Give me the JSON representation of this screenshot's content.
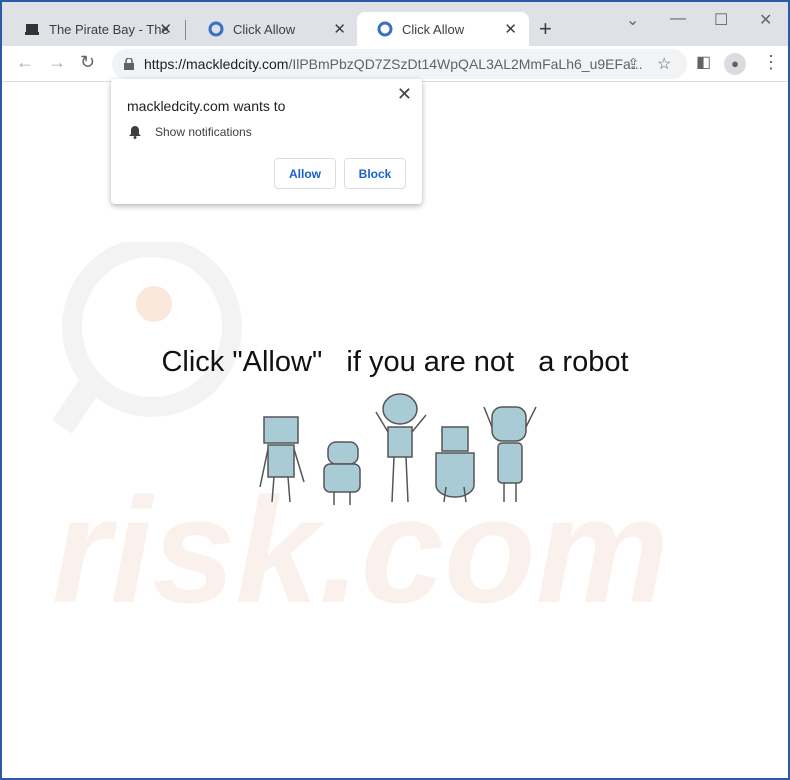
{
  "tabs": [
    {
      "title": "The Pirate Bay - The",
      "icon": "pirate-ship-icon",
      "active": false
    },
    {
      "title": "Click Allow",
      "icon": "page-favicon-icon",
      "active": false
    },
    {
      "title": "Click Allow",
      "icon": "page-favicon-icon",
      "active": true
    }
  ],
  "address": {
    "host": "https://mackledcity.com",
    "path": "/IlPBmPbzQD7ZSzDt14WpQAL3AL2MmFaLh6_u9EFa..."
  },
  "popup": {
    "title": "mackledcity.com wants to",
    "permission": "Show notifications",
    "allow": "Allow",
    "block": "Block"
  },
  "page": {
    "headline": "Click \"Allow\"   if you are not   a robot"
  },
  "watermark": "risk.com",
  "colors": {
    "border": "#2b5aa6",
    "button_text": "#1a62c8",
    "robot": "#a9cbd6"
  }
}
